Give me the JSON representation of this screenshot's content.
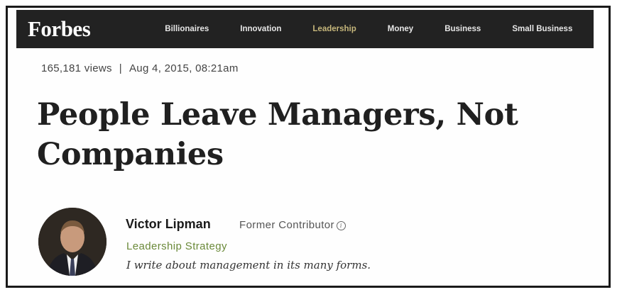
{
  "brand": {
    "logo_text": "Forbes"
  },
  "nav": {
    "items": [
      {
        "label": "Billionaires",
        "active": false
      },
      {
        "label": "Innovation",
        "active": false
      },
      {
        "label": "Leadership",
        "active": true
      },
      {
        "label": "Money",
        "active": false
      },
      {
        "label": "Business",
        "active": false
      },
      {
        "label": "Small Business",
        "active": false
      }
    ]
  },
  "article": {
    "views": "165,181 views",
    "separator": "|",
    "date": "Aug 4, 2015, 08:21am",
    "title": "People Leave Managers, Not Companies"
  },
  "author": {
    "name": "Victor Lipman",
    "role": "Former Contributor",
    "info_icon": "info-icon",
    "topic": "Leadership Strategy",
    "bio": "I write about management in its many forms."
  },
  "colors": {
    "nav_background": "#222222",
    "nav_active": "#c5b67b",
    "topic_accent": "#6b8a3a"
  }
}
